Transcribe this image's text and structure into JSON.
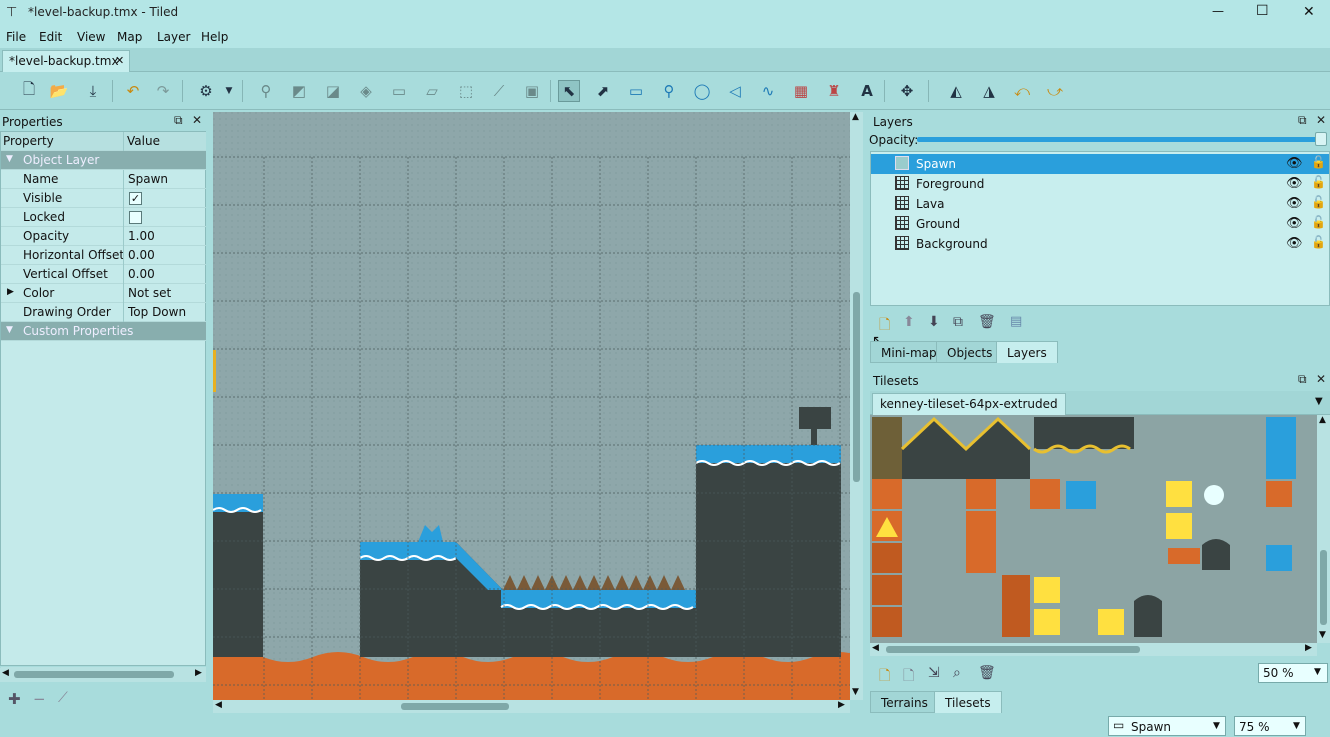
{
  "window": {
    "title": "*level-backup.tmx - Tiled",
    "min": "—",
    "max": "☐",
    "close": "✕"
  },
  "menu": [
    "File",
    "Edit",
    "View",
    "Map",
    "Layer",
    "Help"
  ],
  "document_tab": {
    "label": "*level-backup.tmx",
    "close": "✕"
  },
  "properties": {
    "title": "Properties",
    "col_property": "Property",
    "col_value": "Value",
    "section_object_layer": "Object Layer",
    "rows": [
      {
        "key": "Name",
        "value": "Spawn"
      },
      {
        "key": "Visible",
        "value": "✓"
      },
      {
        "key": "Locked",
        "value": ""
      },
      {
        "key": "Opacity",
        "value": "1.00"
      },
      {
        "key": "Horizontal Offset",
        "value": "0.00"
      },
      {
        "key": "Vertical Offset",
        "value": "0.00"
      },
      {
        "key": "Color",
        "value": "Not set"
      },
      {
        "key": "Drawing Order",
        "value": "Top Down"
      }
    ],
    "section_custom": "Custom Properties"
  },
  "layers": {
    "title": "Layers",
    "opacity_label": "Opacity:",
    "opacity": 1.0,
    "items": [
      {
        "name": "Spawn",
        "type": "object",
        "selected": true
      },
      {
        "name": "Foreground",
        "type": "tile",
        "selected": false
      },
      {
        "name": "Lava",
        "type": "tile",
        "selected": false
      },
      {
        "name": "Ground",
        "type": "tile",
        "selected": false
      },
      {
        "name": "Background",
        "type": "tile",
        "selected": false
      }
    ],
    "tabs": [
      "Mini-map",
      "Objects",
      "Layers"
    ]
  },
  "tilesets": {
    "title": "Tilesets",
    "active_tab": "kenney-tileset-64px-extruded",
    "zoom": "50 %",
    "tabs": [
      "Terrains",
      "Tilesets"
    ]
  },
  "status": {
    "layer": "Spawn",
    "zoom": "75 %"
  },
  "colors": {
    "accent": "#1e9ad6",
    "ground": "#3a4443",
    "water": "#2a9fdc",
    "lava": "#d86a2a"
  }
}
